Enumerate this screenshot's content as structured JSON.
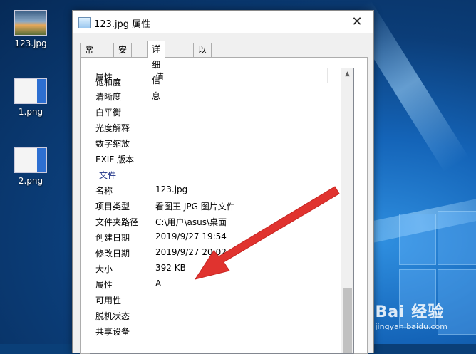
{
  "desktop": {
    "icons": [
      {
        "label": "123.jpg"
      },
      {
        "label": "1.png"
      },
      {
        "label": "2.png"
      }
    ]
  },
  "dialog": {
    "title": "123.jpg 属性",
    "close_glyph": "✕",
    "tabs": [
      "常规",
      "安全",
      "详细信息",
      "以前的版本"
    ],
    "active_tab": "详细信息",
    "list": {
      "header": {
        "col1": "属性",
        "col2": "值"
      },
      "rows_before_group": [
        {
          "key": "饱和度",
          "value": ""
        },
        {
          "key": "清晰度",
          "value": ""
        },
        {
          "key": "白平衡",
          "value": ""
        },
        {
          "key": "光度解释",
          "value": ""
        },
        {
          "key": "数字缩放",
          "value": ""
        },
        {
          "key": "EXIF 版本",
          "value": ""
        }
      ],
      "group_label": "文件",
      "rows_after_group": [
        {
          "key": "名称",
          "value": "123.jpg"
        },
        {
          "key": "项目类型",
          "value": "看图王 JPG 图片文件"
        },
        {
          "key": "文件夹路径",
          "value": "C:\\用户\\asus\\桌面"
        },
        {
          "key": "创建日期",
          "value": "2019/9/27 19:54"
        },
        {
          "key": "修改日期",
          "value": "2019/9/27 20:02"
        },
        {
          "key": "大小",
          "value": "392 KB"
        },
        {
          "key": "属性",
          "value": "A"
        },
        {
          "key": "可用性",
          "value": ""
        },
        {
          "key": "脱机状态",
          "value": ""
        },
        {
          "key": "共享设备",
          "value": ""
        }
      ]
    }
  },
  "watermark": {
    "brand": "Bai 经验",
    "url": "jingyan.baidu.com"
  },
  "colors": {
    "annotation_arrow": "#e0332f",
    "group_label": "#1e3287",
    "desktop": "#0b3d78"
  }
}
